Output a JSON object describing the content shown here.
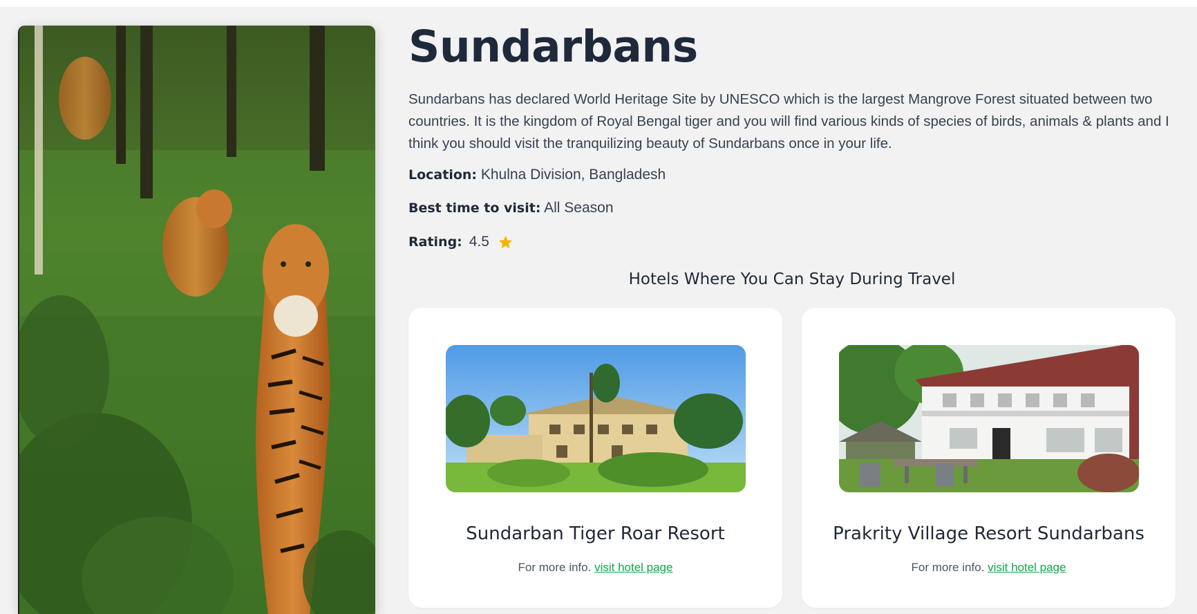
{
  "destination": {
    "title": "Sundarbans",
    "description": "Sundarbans has declared World Heritage Site by UNESCO which is the largest Mangrove Forest situated between two countries. It is the kingdom of Royal Bengal tiger and you will find various kinds of species of birds, animals & plants and I think you should visit the tranquilizing beauty of Sundarbans once in your life.",
    "location_label": "Location:",
    "location_value": "Khulna Division, Bangladesh",
    "best_time_label": "Best time to visit:",
    "best_time_value": "All Season",
    "rating_label": "Rating:",
    "rating_value": "4.5",
    "rating_icon": "star-icon",
    "hero_image": "tiger-photo"
  },
  "hotels": {
    "heading": "Hotels Where You Can Stay During Travel",
    "items": [
      {
        "name": "Sundarban Tiger Roar Resort",
        "info_text": "For more info.",
        "link_text": "visit hotel page",
        "photo": "resort-building-photo"
      },
      {
        "name": "Prakrity Village Resort Sundarbans",
        "info_text": "For more info.",
        "link_text": "visit hotel page",
        "photo": "village-resort-photo"
      }
    ]
  },
  "colors": {
    "background": "#f2f2f2",
    "heading": "#1e293b",
    "link": "#16a34a",
    "star": "#f5b301",
    "card": "#ffffff"
  }
}
